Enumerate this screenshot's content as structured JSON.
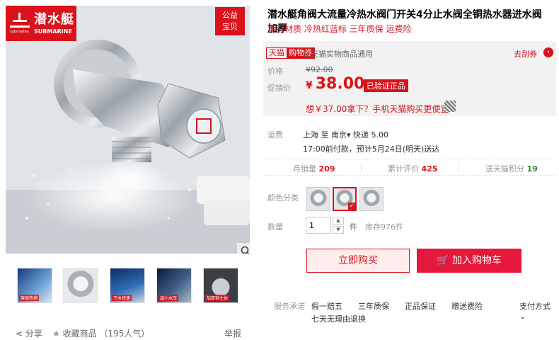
{
  "brand": {
    "cn": "潜水艇",
    "en": "SUBMARINE",
    "logo_tag": "submarine"
  },
  "badge": {
    "line1": "公益",
    "line2": "宝贝"
  },
  "gallery": {
    "thumbs": [
      {
        "label": "旗舰热销"
      },
      {
        "label": ""
      },
      {
        "label": "下水快速"
      },
      {
        "label": "减小水压"
      },
      {
        "label": "加厚铜主体"
      }
    ]
  },
  "actions": {
    "share": "分享",
    "favorite": "收藏商品",
    "popularity": "（195人气）",
    "report": "举报"
  },
  "product": {
    "title": "潜水艇角阀大流量冷热水阀门开关4分止水阀全铜热水器进水阀加厚",
    "subtitle": "黄铜材质 冷热红蓝标 三年质保 运费险"
  },
  "promo": {
    "tmall_label": "天猫",
    "coupon_label": "购物券",
    "coupon_note": "全天猫实物商品通用",
    "go_coupon": "去刮券",
    "price_label": "价格",
    "price_old": "¥92.00",
    "promo_label": "促销价",
    "currency": "¥",
    "price_now": "38.00",
    "verify": "已验证正品",
    "phone_line": "想￥37.00拿下？手机天猫购买更便宜"
  },
  "shipping": {
    "label": "运费",
    "route": "上海  至 南京▾  快递 5.00",
    "time": "17:00前付款，预计5月24日(明天)送达"
  },
  "stats": [
    {
      "label": "月销量",
      "value": "209"
    },
    {
      "label": "累计评价",
      "value": "425"
    },
    {
      "label": "送天猫积分",
      "value": "19"
    }
  ],
  "colors": {
    "label": "颜色分类"
  },
  "quantity": {
    "label": "数量",
    "value": "1",
    "unit": "件",
    "stock": "库存976件"
  },
  "buttons": {
    "buy_now": "立即购买",
    "add_cart": "加入购物车"
  },
  "services": {
    "label": "服务承诺",
    "items": [
      "假一赔五",
      "三年质保",
      "正品保证",
      "赠送费险"
    ],
    "extra": "七天无理由退换",
    "pay": "支付方式"
  }
}
